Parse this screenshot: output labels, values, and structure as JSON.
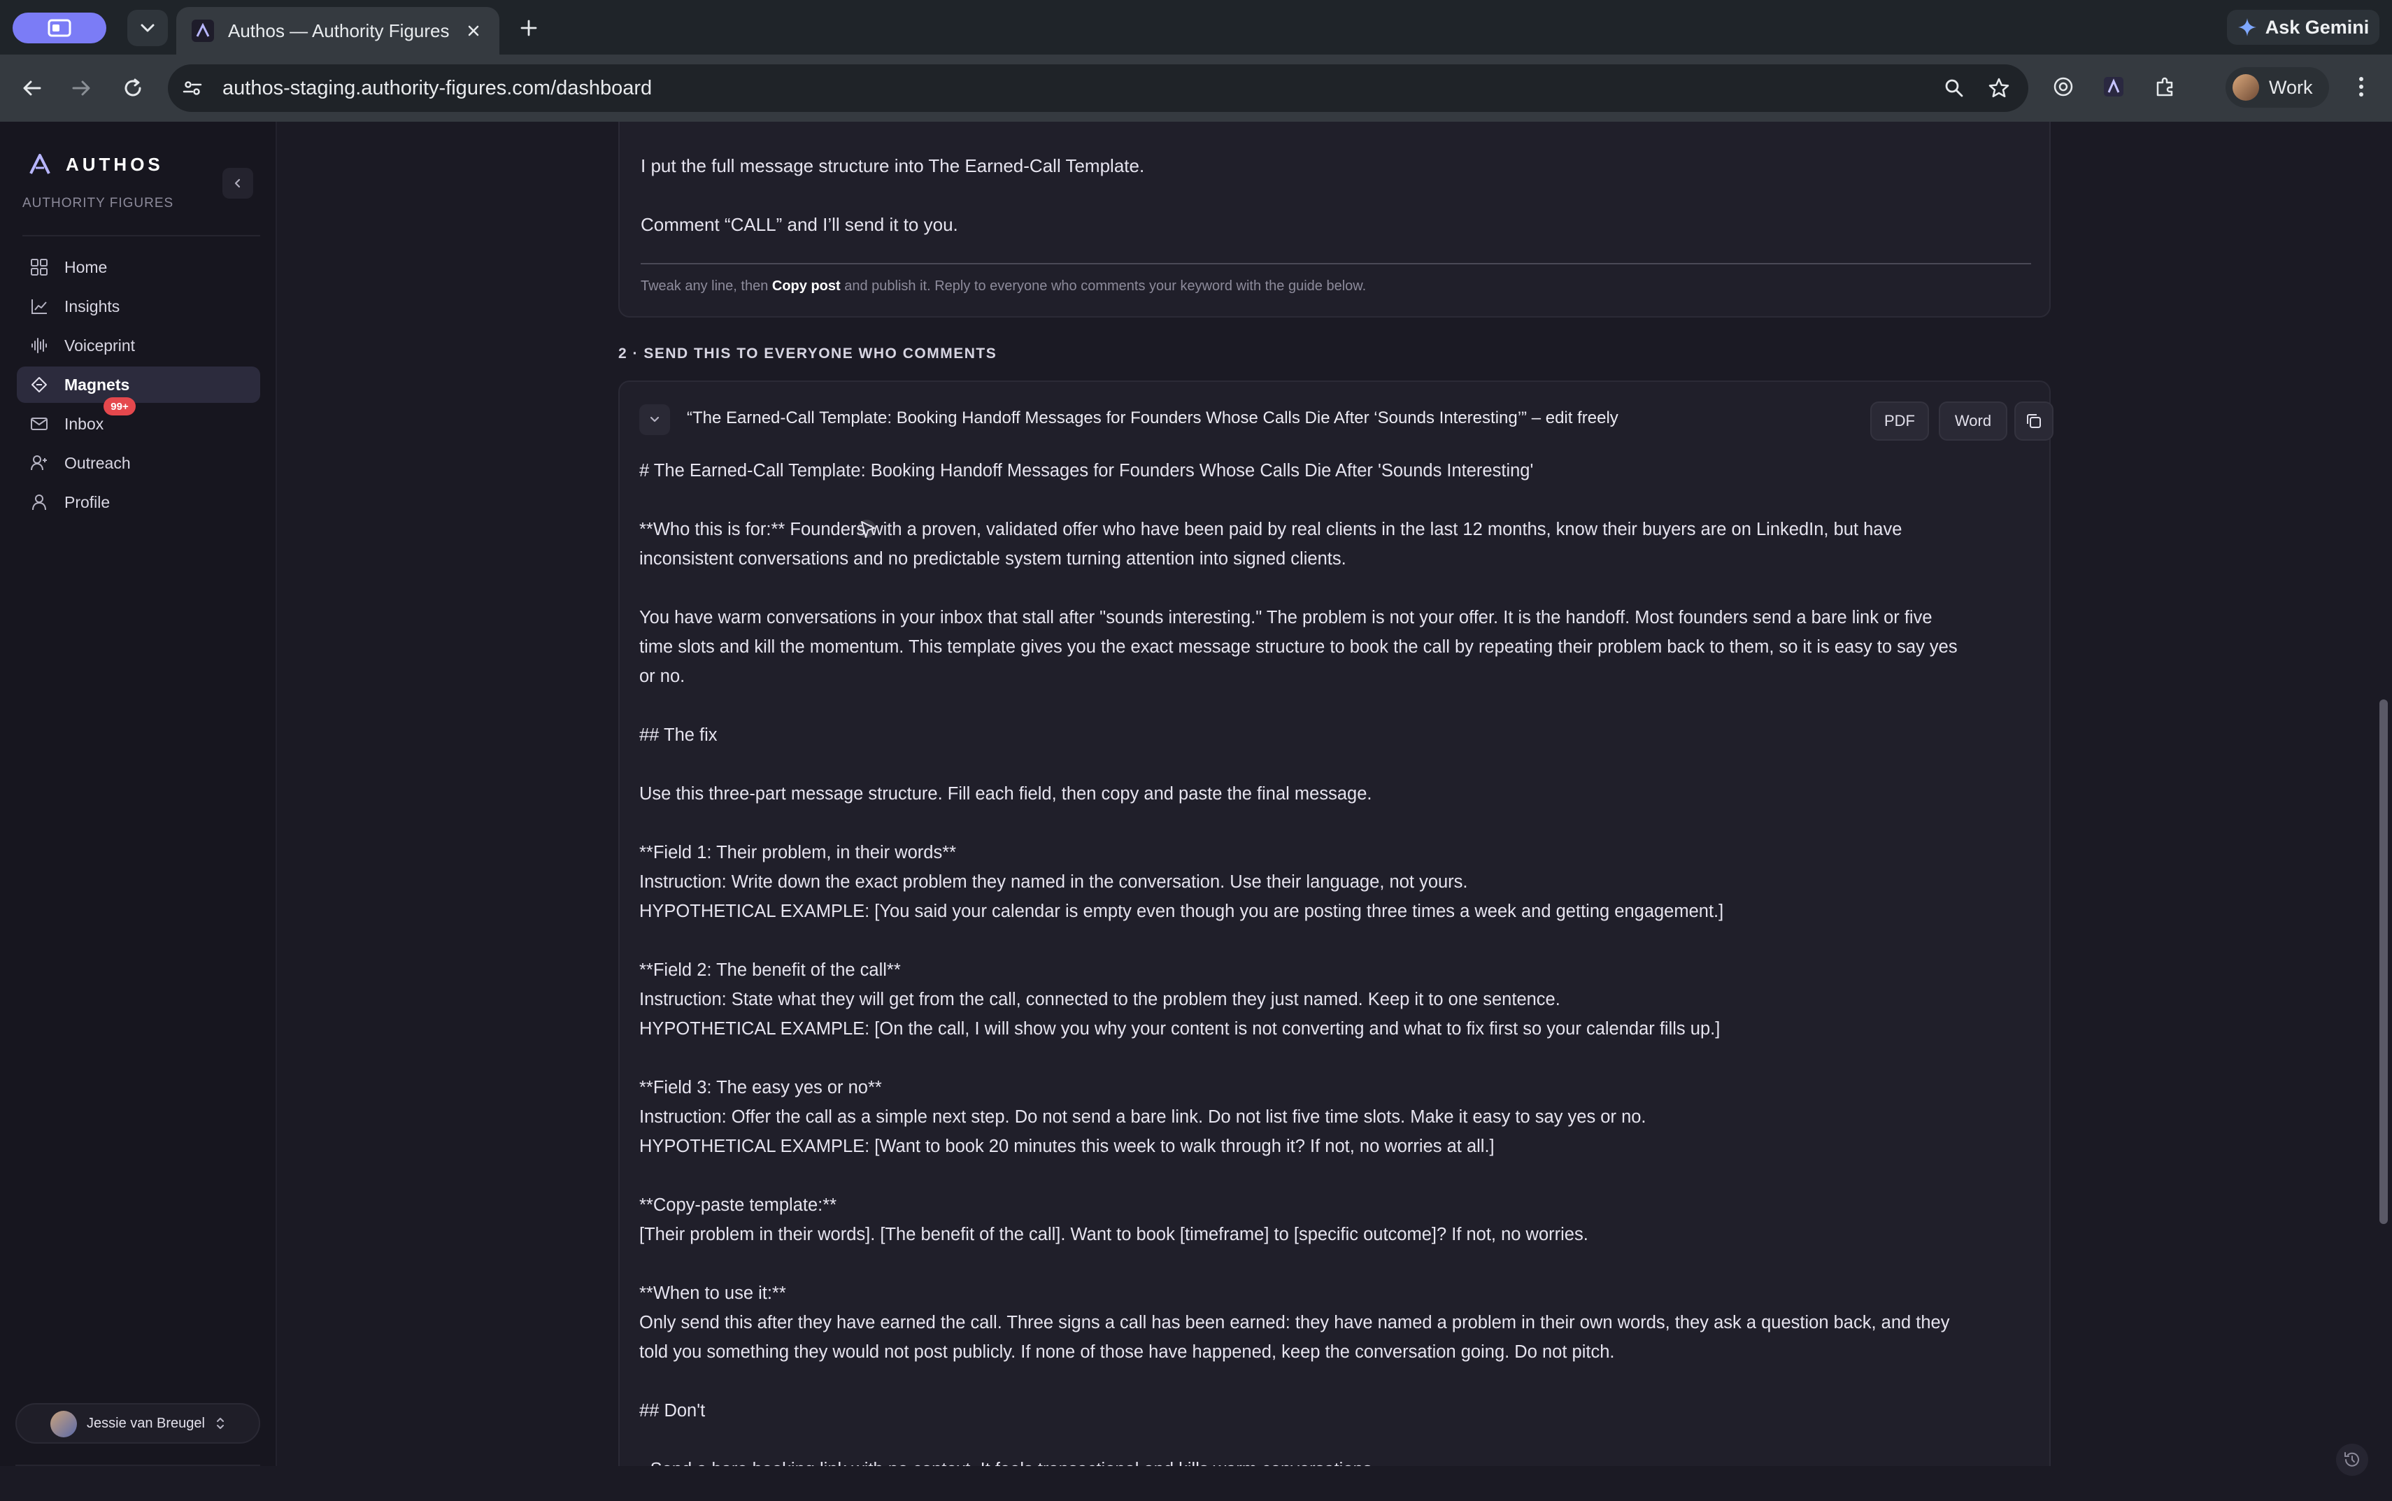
{
  "browser": {
    "tab_title": "Authos — Authority Figures",
    "url": "authos-staging.authority-figures.com/dashboard",
    "gemini_label": "Ask Gemini",
    "profile_label": "Work"
  },
  "sidebar": {
    "brand": "AUTHOS",
    "brand_sub": "AUTHORITY FIGURES",
    "items": [
      {
        "label": "Home",
        "icon": "grid-icon"
      },
      {
        "label": "Insights",
        "icon": "chart-line-icon"
      },
      {
        "label": "Voiceprint",
        "icon": "waveform-icon"
      },
      {
        "label": "Magnets",
        "icon": "magnet-icon",
        "active": true
      },
      {
        "label": "Inbox",
        "icon": "mail-icon",
        "badge": "99+"
      },
      {
        "label": "Outreach",
        "icon": "user-plus-icon"
      },
      {
        "label": "Profile",
        "icon": "user-icon"
      }
    ],
    "user_name": "Jessie van Breugel"
  },
  "post": {
    "line1": "I put the full message structure into The Earned-Call Template.",
    "line2": "Comment “CALL” and I’ll send it to you.",
    "hint_prefix": "Tweak any line, then ",
    "hint_bold": "Copy post",
    "hint_suffix": " and publish it. Reply to everyone who comments your keyword with the guide below."
  },
  "section2": {
    "label": "2 · SEND THIS TO EVERYONE WHO COMMENTS",
    "doc_title": "“The Earned-Call Template: Booking Handoff Messages for Founders Whose Calls Die After ‘Sounds Interesting’” – edit freely",
    "pdf_label": "PDF",
    "word_label": "Word",
    "body": "# The Earned-Call Template: Booking Handoff Messages for Founders Whose Calls Die After 'Sounds Interesting'\n\n**Who this is for:** Founders with a proven, validated offer who have been paid by real clients in the last 12 months, know their buyers are on LinkedIn, but have\ninconsistent conversations and no predictable system turning attention into signed clients.\n\nYou have warm conversations in your inbox that stall after \"sounds interesting.\" The problem is not your offer. It is the handoff. Most founders send a bare link or five\ntime slots and kill the momentum. This template gives you the exact message structure to book the call by repeating their problem back to them, so it is easy to say yes\nor no.\n\n## The fix\n\nUse this three-part message structure. Fill each field, then copy and paste the final message.\n\n**Field 1: Their problem, in their words**\nInstruction: Write down the exact problem they named in the conversation. Use their language, not yours.\nHYPOTHETICAL EXAMPLE: [You said your calendar is empty even though you are posting three times a week and getting engagement.]\n\n**Field 2: The benefit of the call**\nInstruction: State what they will get from the call, connected to the problem they just named. Keep it to one sentence.\nHYPOTHETICAL EXAMPLE: [On the call, I will show you why your content is not converting and what to fix first so your calendar fills up.]\n\n**Field 3: The easy yes or no**\nInstruction: Offer the call as a simple next step. Do not send a bare link. Do not list five time slots. Make it easy to say yes or no.\nHYPOTHETICAL EXAMPLE: [Want to book 20 minutes this week to walk through it? If not, no worries at all.]\n\n**Copy-paste template:**\n[Their problem in their words]. [The benefit of the call]. Want to book [timeframe] to [specific outcome]? If not, no worries.\n\n**When to use it:**\nOnly send this after they have earned the call. Three signs a call has been earned: they have named a problem in their own words, they ask a question back, and they\ntold you something they would not post publicly. If none of those have happened, keep the conversation going. Do not pitch.\n\n## Don't\n\n- Send a bare booking link with no context. It feels transactional and kills warm conversations."
  }
}
